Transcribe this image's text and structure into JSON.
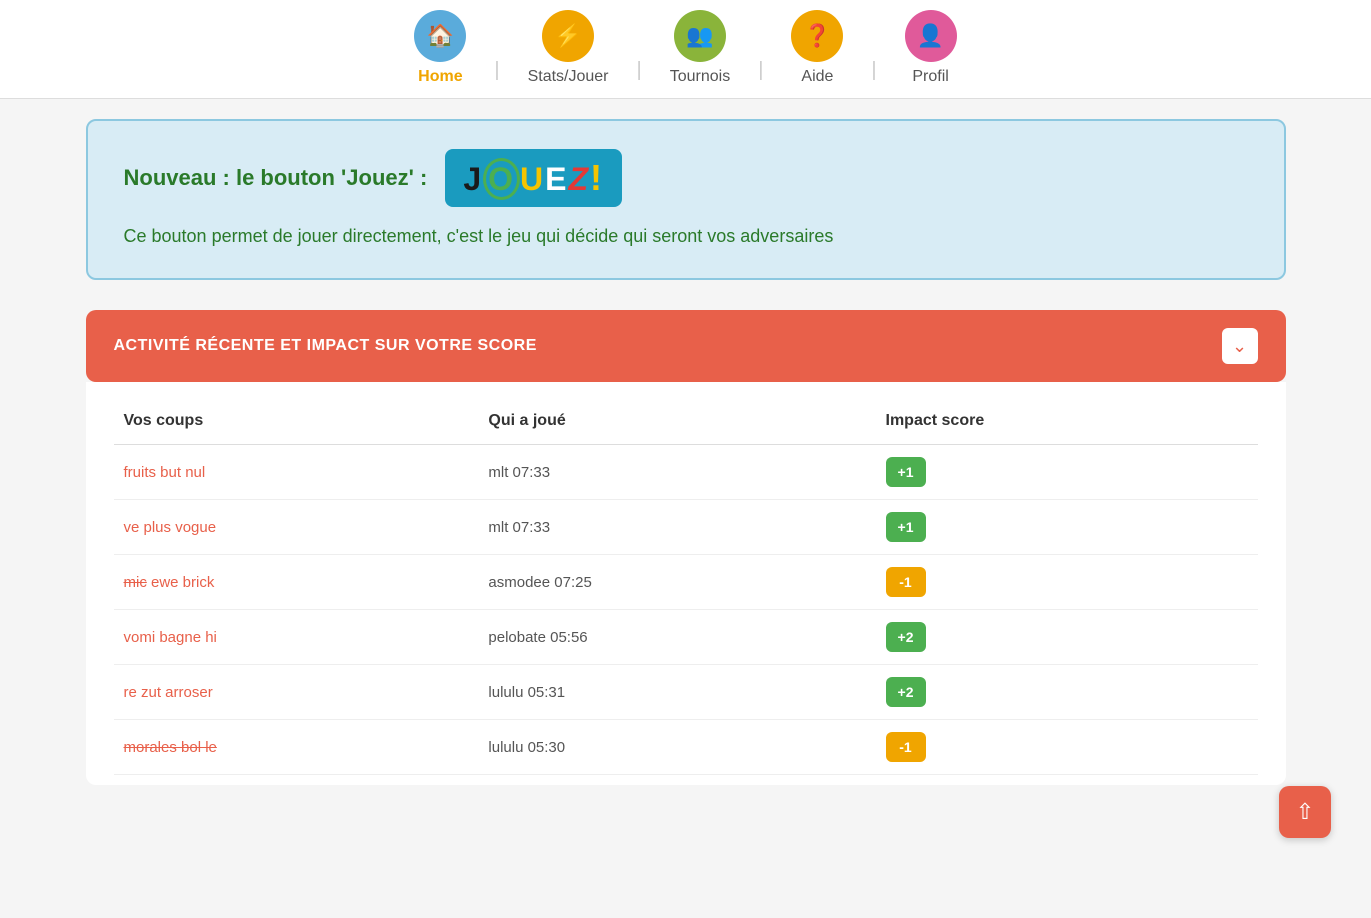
{
  "nav": {
    "items": [
      {
        "id": "home",
        "label": "Home",
        "icon": "🏠",
        "circleClass": "home-circle",
        "active": true
      },
      {
        "id": "stats",
        "label": "Stats/Jouer",
        "icon": "⚡",
        "circleClass": "stats-circle",
        "active": false
      },
      {
        "id": "tournois",
        "label": "Tournois",
        "icon": "👥",
        "circleClass": "tournois-circle",
        "active": false
      },
      {
        "id": "aide",
        "label": "Aide",
        "icon": "❓",
        "circleClass": "aide-circle",
        "active": false
      },
      {
        "id": "profil",
        "label": "Profil",
        "icon": "👤",
        "circleClass": "profil-circle",
        "active": false
      }
    ]
  },
  "announcement": {
    "title": "Nouveau : le bouton 'Jouez' :",
    "desc": "Ce bouton permet de jouer directement, c'est le jeu qui décide qui seront vos adversaires"
  },
  "activity": {
    "header": "ACTIVITÉ RÉCENTE ET IMPACT SUR VOTRE SCORE",
    "columns": {
      "coups": "Vos coups",
      "qui": "Qui a joué",
      "impact": "Impact score"
    },
    "rows": [
      {
        "coup": "fruits but nul",
        "strike": false,
        "partial_strike": false,
        "strike_prefix": "",
        "coup_main": "fruits but nul",
        "qui": "mlt 07:33",
        "score": "+1",
        "score_type": "pos"
      },
      {
        "coup": "ve plus vogue",
        "strike": false,
        "partial_strike": false,
        "strike_prefix": "",
        "coup_main": "ve plus vogue",
        "qui": "mlt 07:33",
        "score": "+1",
        "score_type": "pos"
      },
      {
        "coup": "mic ewe brick",
        "strike": false,
        "partial_strike": true,
        "strike_prefix": "mic",
        "coup_main": " ewe brick",
        "qui": "asmodee 07:25",
        "score": "-1",
        "score_type": "neg"
      },
      {
        "coup": "vomi bagne hi",
        "strike": false,
        "partial_strike": false,
        "strike_prefix": "",
        "coup_main": "vomi bagne hi",
        "qui": "pelobate 05:56",
        "score": "+2",
        "score_type": "pos"
      },
      {
        "coup": "re zut arroser",
        "strike": false,
        "partial_strike": false,
        "strike_prefix": "",
        "coup_main": "re zut arroser",
        "qui": "lululu 05:31",
        "score": "+2",
        "score_type": "pos"
      },
      {
        "coup": "morales bol le",
        "strike": true,
        "partial_strike": false,
        "strike_prefix": "",
        "coup_main": "morales bol le",
        "qui": "lululu 05:30",
        "score": "-1",
        "score_type": "neg"
      }
    ]
  }
}
